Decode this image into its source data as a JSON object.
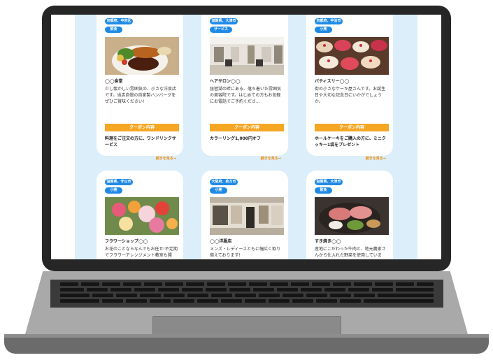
{
  "cards": [
    {
      "location": "京都府、中京区",
      "category": "飲食",
      "name": "◯◯食堂",
      "description": "少し懐かしい雰囲気の、小さな洋食店です。当店自慢の自家製ハンバーグをぜひご賞味ください!",
      "coupon_label": "クーポン内容",
      "offer": "料理をご注文の方に、ワンドリンクサービス",
      "more": "続きを見る→"
    },
    {
      "location": "滋賀県、大津市",
      "category": "サービス",
      "name": "ヘアサロン◯◯",
      "description": "琵琶湖の畔にある、落ち着いた雰囲気の美容院です。はじめての方もお気軽にお電話でご予約くださ...",
      "coupon_label": "クーポン内容",
      "offer": "カラーリング1,000円オフ",
      "more": "続きを見る→"
    },
    {
      "location": "京都府、宇治市",
      "category": "小売",
      "name": "パティスリー◯◯",
      "description": "街の小さなケーキ屋さんです。お誕生日や大切な記念日にいかがでしょうか。",
      "coupon_label": "クーポン内容",
      "offer": "ホールケーキをご購入の方に、ミニクッキー1袋をプレゼント",
      "more": "続きを見る→"
    },
    {
      "location": "滋賀県、守山市",
      "category": "小売",
      "name": "フラワーショップ◯◯",
      "description": "お花のことならなんでもお任せ!不定期でフラワーアレンジメント教室も開"
    },
    {
      "location": "大阪府、枚方市",
      "category": "小売",
      "name": "◯◯洋服店",
      "description": "メンズ・レディースともに幅広く取り揃えております!"
    },
    {
      "location": "滋賀県、大津市",
      "category": "飲食",
      "name": "すき焼き◯◯",
      "description": "産地にこだわった牛肉と、地元農家さんから仕入れた野菜を使用していま"
    }
  ],
  "colors": {
    "badge": "#1f8ae6",
    "coupon": "#f5a623",
    "page_bg": "#dbeefa"
  }
}
